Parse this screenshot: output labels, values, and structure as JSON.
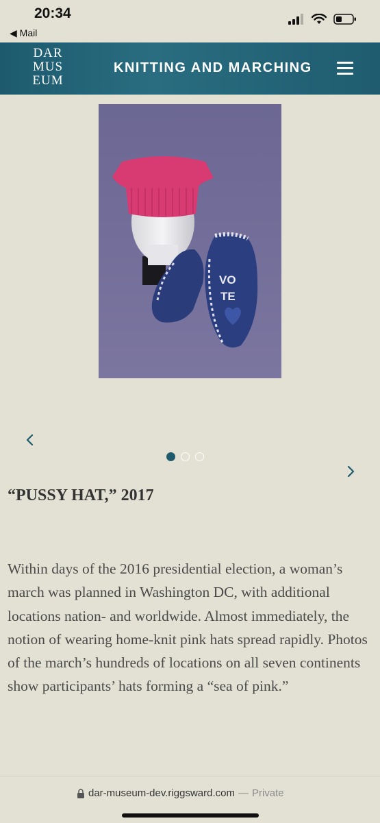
{
  "status_bar": {
    "time": "20:34",
    "back_app": "Mail"
  },
  "header": {
    "logo_lines": [
      "DAR",
      "MUS",
      "EUM"
    ],
    "title": "KNITTING AND MARCHING",
    "menu_icon": "hamburger-menu-icon",
    "colors": {
      "bar": "#1f5c70",
      "text": "#ffffff"
    }
  },
  "carousel": {
    "image_subject": "pink knitted hat on mannequin head with blue VOTE mittens",
    "mitten_text": "VOTE",
    "slide_count": 3,
    "active_slide": 1,
    "prev_icon": "chevron-left-icon",
    "next_icon": "chevron-right-icon",
    "accent_color": "#1f5a6d"
  },
  "article": {
    "title": "“PUSSY HAT,” 2017",
    "body": "Within days of the 2016 presidential election, a woman’s march was planned in Washington DC, with additional locations nation- and worldwide. Almost immediately, the notion of wearing home-knit pink hats spread rapidly. Photos of the march’s hundreds of locations on all seven continents show participants’ hats forming a “sea of pink.”"
  },
  "browser": {
    "url": "dar-museum-dev.riggsward.com",
    "separator": "—",
    "privacy": "Private",
    "lock_icon": "lock-icon"
  }
}
